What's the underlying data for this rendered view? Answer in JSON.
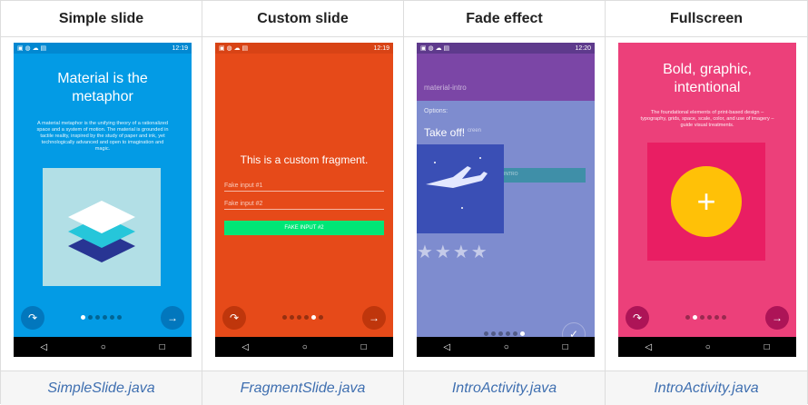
{
  "columns": [
    {
      "header": "Simple slide",
      "footer": "SimpleSlide.java"
    },
    {
      "header": "Custom slide",
      "footer": "FragmentSlide.java"
    },
    {
      "header": "Fade effect",
      "footer": "IntroActivity.java"
    },
    {
      "header": "Fullscreen",
      "footer": "IntroActivity.java"
    }
  ],
  "phones": {
    "simple": {
      "time": "12:19",
      "title": "Material is the metaphor",
      "description": "A material metaphor is the unifying theory of a rationalized space and a system of motion. The material is grounded in tactile reality, inspired by the study of paper and ink, yet technologically advanced and open to imagination and magic.",
      "bg": "#039be5"
    },
    "custom": {
      "time": "12:19",
      "text": "This is a custom fragment.",
      "input1_placeholder": "Fake input #1",
      "input2_placeholder": "Fake input #2",
      "button_label": "FAKE INPUT #2",
      "bg": "#e64a19"
    },
    "fade": {
      "time": "12:20",
      "app_title": "material-intro",
      "options_label": "Options:",
      "overlay_title": "Take off!",
      "hidden_fragment_text": "creen",
      "hidden_button_label": "INTRO",
      "bg": "#7e8ccf"
    },
    "fullscreen": {
      "title": "Bold, graphic, intentional",
      "description": "The foundational elements of print-based design – typography, grids, space, scale, color, and use of imagery – guide visual treatments.",
      "bg": "#ec407a"
    }
  },
  "nav": {
    "back": "◁",
    "home": "○",
    "recents": "□"
  }
}
